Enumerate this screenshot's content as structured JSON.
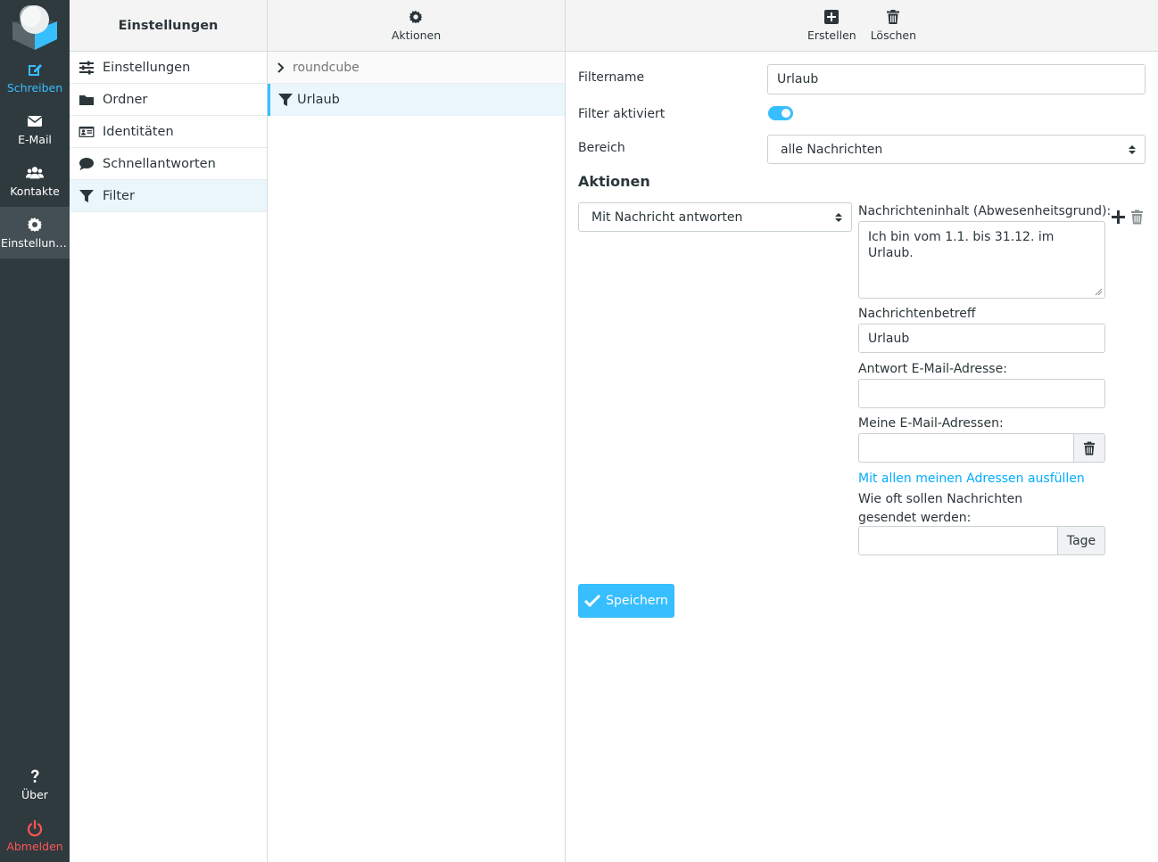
{
  "rail": {
    "compose": "Schreiben",
    "mail": "E-Mail",
    "contacts": "Kontakte",
    "settings": "Einstellung…",
    "about": "Über",
    "logout": "Abmelden"
  },
  "nav": {
    "title": "Einstellungen",
    "items": [
      {
        "label": "Einstellungen",
        "icon": "sliders-icon"
      },
      {
        "label": "Ordner",
        "icon": "folder-icon"
      },
      {
        "label": "Identitäten",
        "icon": "id-card-icon"
      },
      {
        "label": "Schnellantworten",
        "icon": "comment-icon"
      },
      {
        "label": "Filter",
        "icon": "filter-icon"
      }
    ]
  },
  "list": {
    "actions_label": "Aktionen",
    "filter_set": "roundcube",
    "filters": [
      "Urlaub"
    ]
  },
  "toolbar": {
    "create_label": "Erstellen",
    "delete_label": "Löschen"
  },
  "form": {
    "filtername_label": "Filtername",
    "filtername_value": "Urlaub",
    "enabled_label": "Filter aktiviert",
    "scope_label": "Bereich",
    "scope_value": "alle Nachrichten",
    "actions_heading": "Aktionen",
    "action_value": "Mit Nachricht antworten",
    "body_label": "Nachrichteninhalt (Abwesenheitsgrund):",
    "body_value": "Ich bin vom 1.1. bis 31.12. im Urlaub.",
    "subject_label": "Nachrichtenbetreff",
    "subject_value": "Urlaub",
    "reply_address_label": "Antwort E-Mail-Adresse:",
    "reply_address_value": "",
    "my_addresses_label": "Meine E-Mail-Adressen:",
    "my_addresses_value": "",
    "fill_addresses_link": "Mit allen meinen Adressen ausfüllen",
    "frequency_label": "Wie oft sollen Nachrichten gesendet werden:",
    "frequency_value": "",
    "frequency_unit": "Tage",
    "save_label": "Speichern"
  },
  "colors": {
    "accent": "#37beff",
    "rail_bg": "#2f3a3f",
    "logout": "#ff5552"
  }
}
